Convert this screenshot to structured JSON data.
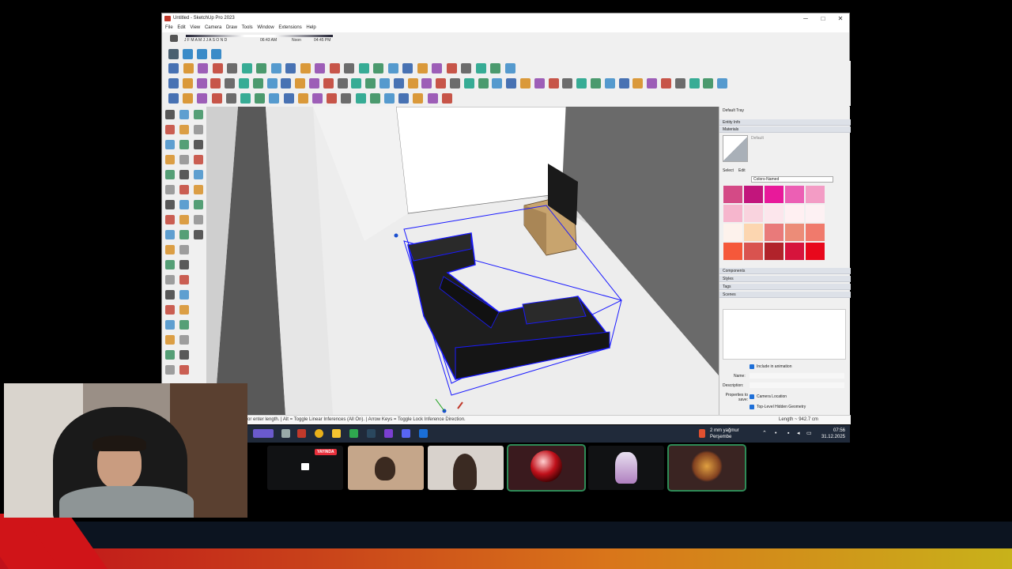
{
  "window": {
    "title": "Untitled - SketchUp Pro 2023",
    "controls": {
      "minimize": "─",
      "maximize": "□",
      "close": "✕"
    }
  },
  "menu": [
    "File",
    "Edit",
    "View",
    "Camera",
    "Draw",
    "Tools",
    "Window",
    "Extensions",
    "Help"
  ],
  "shadows": {
    "months": "J F M A M J J A S O N D",
    "time_start": "06:43 AM",
    "time_mid": "Noon",
    "time_end": "04:45 PM"
  },
  "tray": {
    "title": "Default Tray",
    "sections": {
      "entity_info": "Entity Info",
      "materials": "Materials",
      "components": "Components",
      "styles": "Styles",
      "tags": "Tags",
      "scenes": "Scenes"
    },
    "material_name": "Default",
    "tabs": {
      "select": "Select",
      "edit": "Edit"
    },
    "library": "Colors-Named",
    "swatches": [
      "#d44a86",
      "#c2157c",
      "#e8199a",
      "#ec5fb4",
      "#f39cc5",
      "#f6b6cd",
      "#f9d3de",
      "#fce6ec",
      "#fff0f2",
      "#fdf1f3",
      "#fdf2ec",
      "#fcd6b0",
      "#e97a7a",
      "#ec8c78",
      "#f07a6c",
      "#f5583a",
      "#d9534f",
      "#b1232b",
      "#d6143c",
      "#e8081c"
    ],
    "scenes": {
      "include_in_animation": "Include in animation",
      "name_label": "Name:",
      "description_label": "Description:",
      "properties_label": "Properties to save:",
      "camera_location": "Camera Location",
      "hidden_geometry": "Top-Level Hidden Geometry"
    }
  },
  "status": {
    "text": "or enter length. | Alt = Toggle Linear Inferences (All On). | Arrow Keys = Toggle Lock Inference Direction.",
    "length": "Length ~ 942.7 cm"
  },
  "taskbar": {
    "weather_temp": "2 mm yağmur",
    "weather_day": "Perşembe",
    "time": "07:56",
    "date": "31.12.2025"
  },
  "discord": {
    "live_badge": "YAYINDA"
  },
  "colors": {
    "selection_blue": "#1a1aff",
    "sofa": "#1e1e1e",
    "tv_stand": "#c8a46e"
  }
}
